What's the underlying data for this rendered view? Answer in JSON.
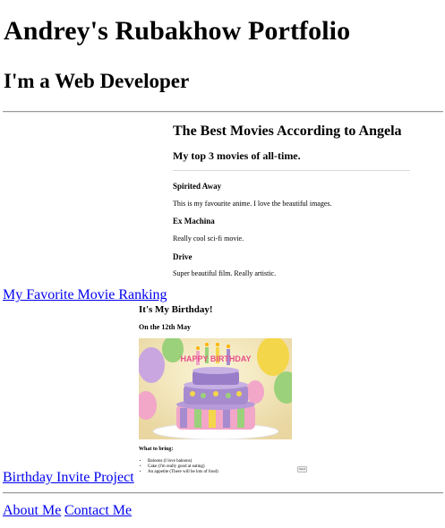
{
  "header": {
    "title": "Andrey's Rubakhow Portfolio",
    "subtitle": "I'm a Web Developer"
  },
  "projects": {
    "movie": {
      "link_label": "My Favorite Movie Ranking",
      "preview": {
        "title": "The Best Movies According to Angela",
        "subtitle": "My top 3 movies of all-time.",
        "movies": [
          {
            "name": "Spirited Away",
            "desc": "This is my favourite anime. I love the beautiful images."
          },
          {
            "name": "Ex Machina",
            "desc": "Really cool sci-fi movie."
          },
          {
            "name": "Drive",
            "desc": "Super beautiful film. Really artistic."
          }
        ]
      }
    },
    "birthday": {
      "link_label": "Birthday Invite Project",
      "preview": {
        "title": "It's My Birthday!",
        "subtitle": "On the 12th May",
        "cake_text": "HAPPY BIRTHDAY",
        "bring_label": "What to bring:",
        "items": [
          "Baloons (I love baloons)",
          "Cake (I'm really good at eating)",
          "An appetite (There will be lots of food)"
        ],
        "button_label": "Send"
      }
    }
  },
  "footer": {
    "about_label": "About Me",
    "contact_label": "Contact Me"
  },
  "colors": {
    "link": "#0000ee",
    "cake_purple": "#a78bcf",
    "cake_pink": "#f2a6c8",
    "cake_yellow": "#f4d64a"
  }
}
